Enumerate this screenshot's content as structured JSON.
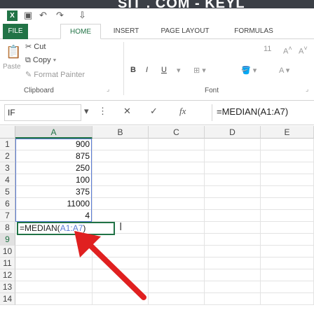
{
  "banner": {
    "text": "SIT . COM - KEYL"
  },
  "quick_access": {
    "save_icon": "save-icon",
    "undo_icon": "undo-icon",
    "redo_icon": "redo-icon"
  },
  "tabs": [
    {
      "label": "FILE"
    },
    {
      "label": "HOME"
    },
    {
      "label": "INSERT"
    },
    {
      "label": "PAGE LAYOUT"
    },
    {
      "label": "FORMULAS"
    }
  ],
  "ribbon": {
    "clipboard": {
      "paste_label": "Paste",
      "cut_label": "Cut",
      "copy_label": "Copy",
      "format_painter_label": "Format Painter",
      "group_label": "Clipboard"
    },
    "font": {
      "bold": "B",
      "italic": "I",
      "underline": "U",
      "font_size": "11",
      "group_label": "Font"
    }
  },
  "formula_bar": {
    "name_box": "IF",
    "cancel": "✕",
    "enter": "✓",
    "fx": "fx",
    "formula": "=MEDIAN(A1:A7)"
  },
  "grid": {
    "columns": [
      "A",
      "B",
      "C",
      "D",
      "E"
    ],
    "rows": [
      "1",
      "2",
      "3",
      "4",
      "5",
      "6",
      "7",
      "8",
      "9",
      "10",
      "11",
      "12",
      "13",
      "14"
    ],
    "values": [
      "900",
      "875",
      "250",
      "100",
      "375",
      "11000",
      "4"
    ],
    "editing_formula_prefix": "=MEDIAN(",
    "editing_formula_ref": "A1:A7",
    "editing_formula_suffix": ")"
  },
  "colors": {
    "accent": "#217346",
    "range": "#5b7bd5",
    "arrow": "#e02020"
  }
}
